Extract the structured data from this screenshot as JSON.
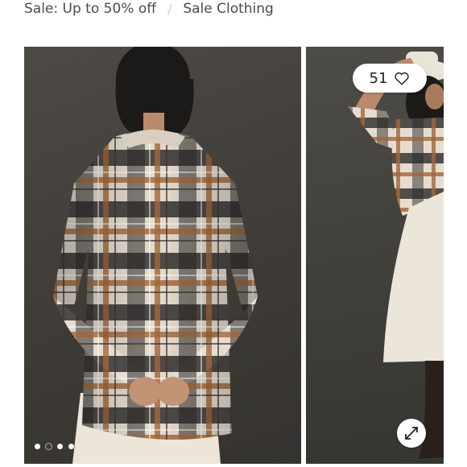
{
  "breadcrumb": {
    "items": [
      {
        "label": "Sale: Up to 50% off"
      },
      {
        "label": "Sale Clothing"
      }
    ],
    "separator": "/"
  },
  "gallery": {
    "like_count": "51",
    "like_icon": "heart-icon",
    "expand_icon": "expand-arrows-icon",
    "dots": {
      "count": 4,
      "active_index": 1
    },
    "slides": [
      {
        "subject": "plaid-shirt-back-view"
      },
      {
        "subject": "plaid-shirt-model-with-hat"
      }
    ]
  },
  "colors": {
    "background": "#ffffff",
    "photo_backdrop": "#45423d",
    "text": "#4b4b4b",
    "separator": "#c8c8c8"
  }
}
